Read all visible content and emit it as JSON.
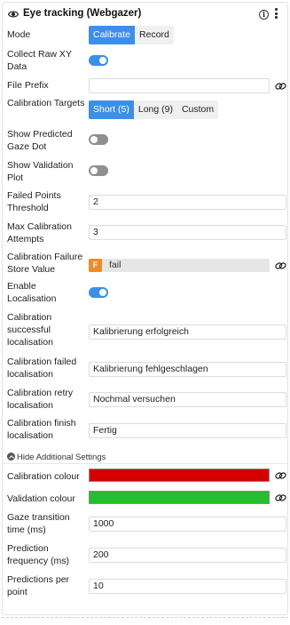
{
  "header": {
    "title": "Eye tracking (Webgazer)",
    "info_icon": "info-icon",
    "menu_icon": "more-vertical-icon",
    "eye_icon": "eye-icon"
  },
  "mode": {
    "label": "Mode",
    "options": [
      "Calibrate",
      "Record"
    ],
    "selected": "Calibrate"
  },
  "collect_raw": {
    "label": "Collect Raw XY Data",
    "value": true
  },
  "file_prefix": {
    "label": "File Prefix",
    "value": ""
  },
  "calibration_targets": {
    "label": "Calibration Targets",
    "options": [
      "Short (5)",
      "Long (9)",
      "Custom"
    ],
    "selected": "Short (5)"
  },
  "show_predicted": {
    "label": "Show Predicted Gaze Dot",
    "value": false
  },
  "show_validation": {
    "label": "Show Validation Plot",
    "value": false
  },
  "failed_points": {
    "label": "Failed Points Threshold",
    "value": "2"
  },
  "max_attempts": {
    "label": "Max Calibration Attempts",
    "value": "3"
  },
  "failure_store": {
    "label": "Calibration Failure Store Value",
    "badge": "F",
    "value": "fail"
  },
  "enable_localisation": {
    "label": "Enable Localisation",
    "value": true
  },
  "cal_success": {
    "label": "Calibration successful localisation",
    "value": "Kalibrierung erfolgreich"
  },
  "cal_failed": {
    "label": "Calibration failed localisation",
    "value": "Kalibrierung fehlgeschlagen"
  },
  "cal_retry": {
    "label": "Calibration retry localisation",
    "value": "Nochmal versuchen"
  },
  "cal_finish": {
    "label": "Calibration finish localisation",
    "value": "Fertig"
  },
  "hide_additional": {
    "label": "Hide Additional Settings"
  },
  "cal_colour": {
    "label": "Calibration colour",
    "color": "#d40000"
  },
  "val_colour": {
    "label": "Validation colour",
    "color": "#22c02a"
  },
  "gaze_transition": {
    "label": "Gaze transition time (ms)",
    "value": "1000"
  },
  "prediction_freq": {
    "label": "Prediction frequency (ms)",
    "value": "200"
  },
  "predictions_per_point": {
    "label": "Predictions per point",
    "value": "10"
  },
  "colors": {
    "accent": "#3c8fe8",
    "badge": "#f08a24"
  }
}
